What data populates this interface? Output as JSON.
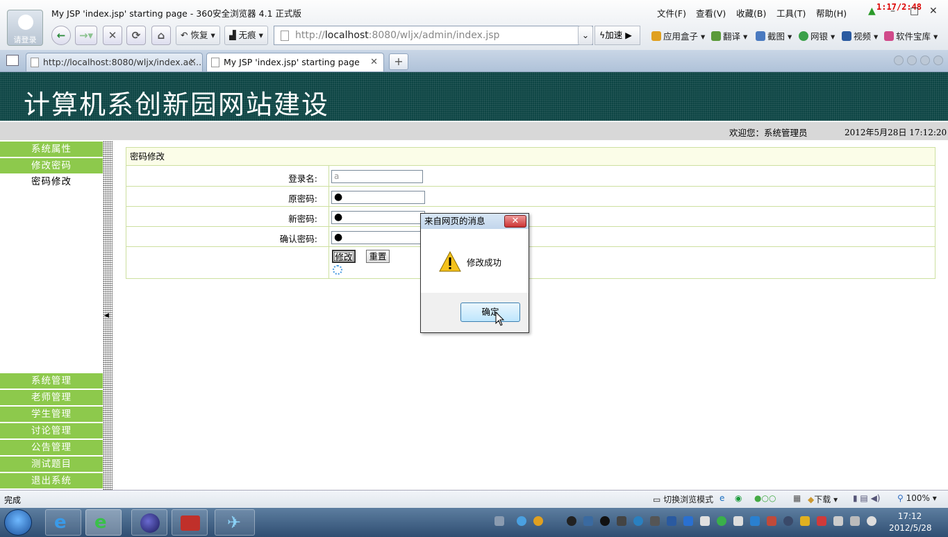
{
  "browser": {
    "window_title": "My JSP 'index.jsp' starting page - 360安全浏览器 4.1 正式版",
    "login_label": "请登录",
    "menus": [
      "文件(F)",
      "查看(V)",
      "收藏(B)",
      "工具(T)",
      "帮助(H)"
    ],
    "overlay_time": "1:17/2:48",
    "restore_label": "恢复",
    "incognito_label": "无痕",
    "address": {
      "proto": "http://",
      "host": "localhost",
      "rest": ":8080/wljx/admin/index.jsp"
    },
    "speed_label": "加速",
    "toolbar": [
      "应用盒子",
      "翻译",
      "截图",
      "网银",
      "视频",
      "软件宝库"
    ],
    "tabs": [
      {
        "label": "http://localhost:8080/wljx/index.ac..."
      },
      {
        "label": "My JSP 'index.jsp' starting page"
      }
    ],
    "status_text": "完成",
    "mode_label": "切换浏览模式",
    "download_label": "下载",
    "zoom": "100%"
  },
  "site": {
    "title": "计算机系创新园网站建设",
    "welcome": "欢迎您：系统管理员",
    "datetime": "2012年5月28日  17:12:20"
  },
  "sidebar": {
    "top": [
      "系统属性",
      "修改密码"
    ],
    "current": "密码修改",
    "bottom": [
      "系统管理",
      "老师管理",
      "学生管理",
      "讨论管理",
      "公告管理",
      "测试题目",
      "退出系统"
    ]
  },
  "form": {
    "heading": "密码修改",
    "login_label": "登录名:",
    "login_value": "a",
    "old_label": "原密码:",
    "new_label": "新密码:",
    "confirm_label": "确认密码:",
    "mask": "●",
    "save_label": "修改",
    "reset_label": "重置"
  },
  "dialog": {
    "title": "来自网页的消息",
    "close": "✕",
    "message": "修改成功",
    "ok": "确定"
  },
  "taskbar": {
    "time": "17:12",
    "date": "2012/5/28"
  }
}
